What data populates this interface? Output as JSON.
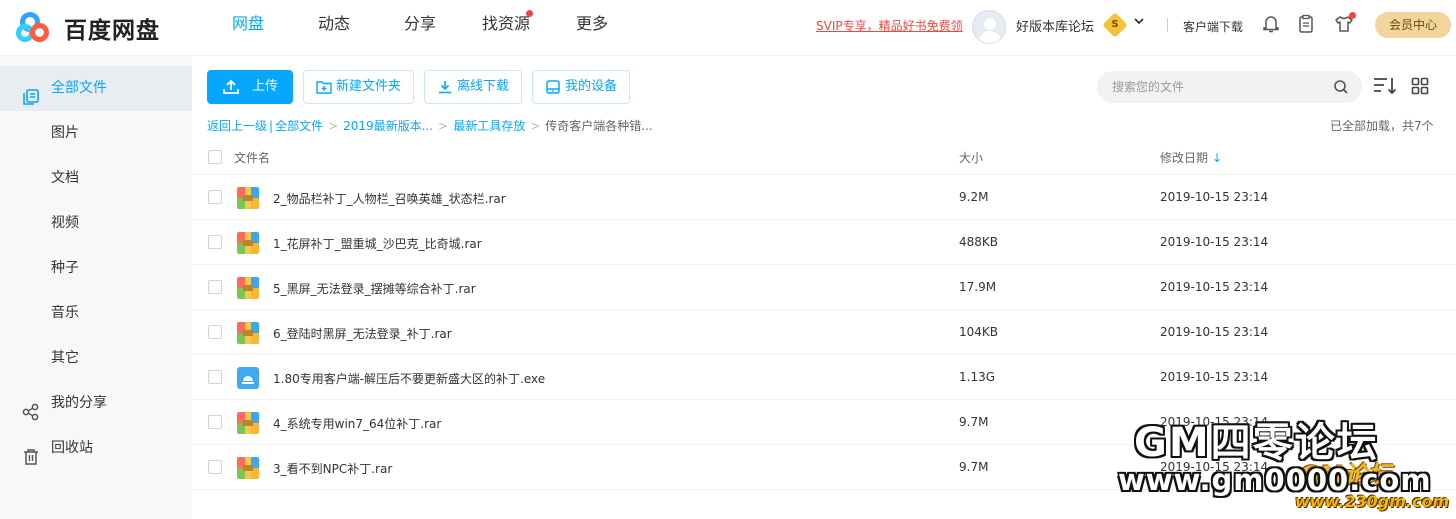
{
  "header": {
    "logo_text": "百度网盘",
    "nav": [
      {
        "label": "网盘",
        "active": true
      },
      {
        "label": "动态",
        "active": false
      },
      {
        "label": "分享",
        "active": false
      },
      {
        "label": "找资源",
        "active": false,
        "dot": true
      },
      {
        "label": "更多",
        "active": false
      }
    ],
    "svip_promo": "SVIP专享，精品好书免费领",
    "username": "好版本库论坛",
    "vip_badge": "S",
    "client_download": "客户端下载",
    "member_center": "会员中心"
  },
  "sidebar": {
    "items": [
      {
        "label": "全部文件",
        "icon": "files-icon",
        "active": true
      },
      {
        "label": "图片"
      },
      {
        "label": "文档"
      },
      {
        "label": "视频"
      },
      {
        "label": "种子"
      },
      {
        "label": "音乐"
      },
      {
        "label": "其它"
      },
      {
        "label": "我的分享",
        "icon": "share-icon"
      },
      {
        "label": "回收站",
        "icon": "trash-icon"
      }
    ]
  },
  "toolbar": {
    "upload": "上传",
    "new_folder": "新建文件夹",
    "offline_download": "离线下载",
    "my_devices": "我的设备",
    "search_placeholder": "搜索您的文件"
  },
  "breadcrumb": {
    "back": "返回上一级",
    "items": [
      "全部文件",
      "2019最新版本...",
      "最新工具存放"
    ],
    "current": "传奇客户端各种错...",
    "loaded_status": "已全部加载，共7个"
  },
  "table": {
    "headers": {
      "name": "文件名",
      "size": "大小",
      "date": "修改日期"
    },
    "rows": [
      {
        "name": "2_物品栏补丁_人物栏_召唤英雄_状态栏.rar",
        "size": "9.2M",
        "date": "2019-10-15 23:14",
        "type": "rar"
      },
      {
        "name": "1_花屏补丁_盟重城_沙巴克_比奇城.rar",
        "size": "488KB",
        "date": "2019-10-15 23:14",
        "type": "rar"
      },
      {
        "name": "5_黑屏_无法登录_摆摊等综合补丁.rar",
        "size": "17.9M",
        "date": "2019-10-15 23:14",
        "type": "rar"
      },
      {
        "name": "6_登陆时黑屏_无法登录_补丁.rar",
        "size": "104KB",
        "date": "2019-10-15 23:14",
        "type": "rar"
      },
      {
        "name": "1.80专用客户端-解压后不要更新盛大区的补丁.exe",
        "size": "1.13G",
        "date": "2019-10-15 23:14",
        "type": "exe"
      },
      {
        "name": "4_系统专用win7_64位补丁.rar",
        "size": "9.7M",
        "date": "2019-10-15 23:14",
        "type": "rar"
      },
      {
        "name": "3_看不到NPC补丁.rar",
        "size": "9.7M",
        "date": "2019-10-15 23:14",
        "type": "rar"
      }
    ]
  },
  "watermark": {
    "line1": "GM四零论坛",
    "line2": "www.gm0000.com",
    "line3": "www.230gm.com",
    "line4": "GM论坛"
  },
  "colors": {
    "accent": "#06a7ff",
    "alert": "#f5453f",
    "vip": "#f2d59d"
  }
}
